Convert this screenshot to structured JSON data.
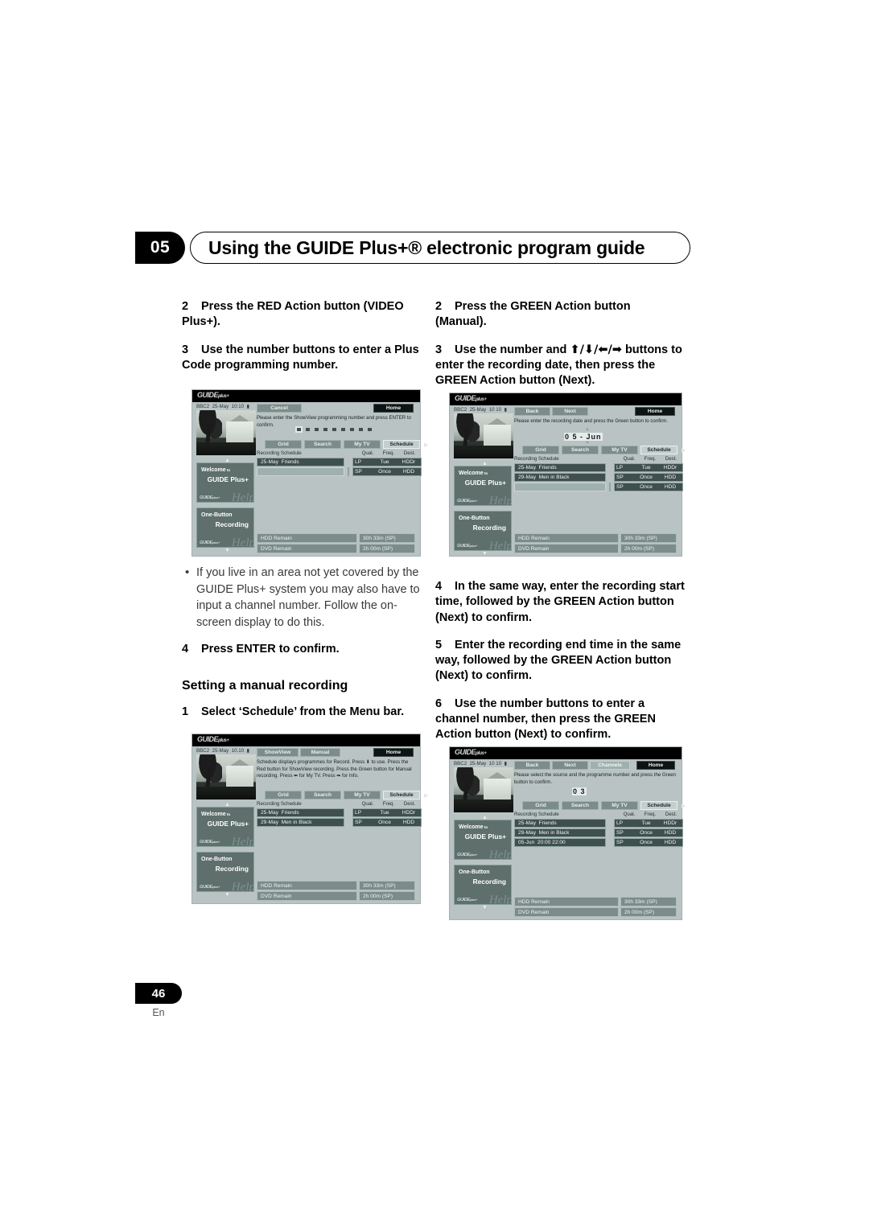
{
  "header": {
    "chapter": "05",
    "title": "Using the GUIDE Plus+® electronic program guide"
  },
  "footer": {
    "page": "46",
    "lang": "En"
  },
  "left_column": {
    "step2": {
      "num": "2",
      "text": "Press the RED Action button (VIDEO Plus+)."
    },
    "step3": {
      "num": "3",
      "text": "Use the number buttons to enter a Plus Code  programming number."
    },
    "bullet": "If you live in an area not yet covered by the GUIDE Plus+ system you may also have to input a channel number. Follow the on-screen display to do this.",
    "step4": {
      "num": "4",
      "text": "Press ENTER to confirm."
    },
    "subhead": "Setting a manual recording",
    "step1": {
      "num": "1",
      "text": "Select ‘Schedule’ from the Menu bar."
    }
  },
  "right_column": {
    "step2": {
      "num": "2",
      "text": "Press the GREEN Action button (Manual)."
    },
    "step3": {
      "num": "3",
      "pre": "Use the number and ",
      "arrows": "⬆/⬇/⬅/➡",
      "post": " buttons to enter the recording date, then press the GREEN Action button (Next)."
    },
    "step4": {
      "num": "4",
      "text": "In the same way, enter the recording start time, followed by the GREEN Action button (Next) to confirm."
    },
    "step5": {
      "num": "5",
      "text": "Enter the recording end time in the same way, followed by the GREEN Action button (Next) to confirm."
    },
    "step6": {
      "num": "6",
      "text": "Use the number buttons to enter a channel number, then press the GREEN Action button (Next) to confirm."
    }
  },
  "screens": {
    "showview_entry": {
      "logo": "GUIDE",
      "logo_sm": "plus+",
      "channel": "BBC2",
      "date": "25-May",
      "time": "10:10",
      "lock": "🔒",
      "buttons": [
        "Cancel",
        "Home"
      ],
      "message": "Please enter the ShowView programming number and press ENTER to confirm.",
      "digit_count": 9,
      "tabs": [
        "Grid",
        "Search",
        "My TV",
        "Schedule"
      ],
      "active_tab": "Schedule",
      "schedule_label": "Recording Schedule",
      "columns": [
        "Qual.",
        "Freq.",
        "Dest."
      ],
      "rows": [
        {
          "date": "25-May",
          "title": "Friends",
          "qual": "LP",
          "freq": "Tue",
          "dest": "HDDr"
        },
        {
          "date": "",
          "title": "",
          "qual": "SP",
          "freq": "Once",
          "dest": "HDD"
        }
      ],
      "cards": [
        {
          "l1": "Welcome",
          "l1_tiny": "to",
          "l2": "GUIDE Plus+"
        },
        {
          "l1": "One-Button",
          "l1_tiny": "",
          "l2": "Recording"
        }
      ],
      "remain": [
        {
          "label": "HDD Remain",
          "value": "30h 33m (SP)"
        },
        {
          "label": "DVD Remain",
          "value": "2h 00m (SP)"
        }
      ]
    },
    "manual_date": {
      "logo": "GUIDE",
      "logo_sm": "plus+",
      "channel": "BBC2",
      "date": "25-May",
      "time": "10 10",
      "lock": "🔒",
      "buttons": [
        "Back",
        "Next",
        "Home"
      ],
      "message": "Please enter the recording date and press the Green button to confirm.",
      "value": "0 5 - Jun",
      "tabs": [
        "Grid",
        "Search",
        "My TV",
        "Schedule"
      ],
      "active_tab": "Schedule",
      "schedule_label": "Recording Schedule",
      "columns": [
        "Qual.",
        "Freq.",
        "Dest."
      ],
      "rows": [
        {
          "date": "25-May",
          "title": "Friends",
          "qual": "LP",
          "freq": "Tue",
          "dest": "HDDr"
        },
        {
          "date": "29-May",
          "title": "Men in Black",
          "qual": "SP",
          "freq": "Once",
          "dest": "HDD"
        },
        {
          "date": "",
          "title": "",
          "qual": "SP",
          "freq": "Once",
          "dest": "HDD"
        }
      ],
      "cards": [
        {
          "l1": "Welcome",
          "l1_tiny": "to",
          "l2": "GUIDE Plus+"
        },
        {
          "l1": "One-Button",
          "l1_tiny": "",
          "l2": "Recording"
        }
      ],
      "remain": [
        {
          "label": "HDD Remain",
          "value": "30h 33m (SP)"
        },
        {
          "label": "DVD Remain",
          "value": "2h 00m (SP)"
        }
      ]
    },
    "schedule_menu": {
      "logo": "GUIDE",
      "logo_sm": "plus+",
      "channel": "BBC2",
      "date": "25-May",
      "time": "10.10",
      "lock": "🔒",
      "buttons": [
        "ShowView",
        "Manual",
        "Home"
      ],
      "message": "Schedule displays programmes for Record. Press ⬇ to use. Press the Red button for ShowView recording. Press the Green button for Manual recording. Press ⬅ for My TV. Press ➡ for Info.",
      "tabs": [
        "Grid",
        "Search",
        "My TV",
        "Schedule"
      ],
      "active_tab": "Schedule",
      "schedule_label": "Recording Schedule",
      "columns": [
        "Qual.",
        "Freq.",
        "Dest."
      ],
      "rows": [
        {
          "date": "25-May",
          "title": "Friends",
          "qual": "LP",
          "freq": "Tue",
          "dest": "HDDr"
        },
        {
          "date": "29-May",
          "title": "Men in Black",
          "qual": "SP",
          "freq": "Once",
          "dest": "HDD"
        }
      ],
      "cards": [
        {
          "l1": "Welcome",
          "l1_tiny": "to",
          "l2": "GUIDE Plus+"
        },
        {
          "l1": "One-Button",
          "l1_tiny": "",
          "l2": "Recording"
        }
      ],
      "remain": [
        {
          "label": "HDD Remain",
          "value": "30h 33m (SP)"
        },
        {
          "label": "DVD Remain",
          "value": "2h 00m (SP)"
        }
      ]
    },
    "manual_channel": {
      "logo": "GUIDE",
      "logo_sm": "plus+",
      "channel": "BBC2",
      "date": "25-May",
      "time": "10 10",
      "lock": "🔒",
      "buttons": [
        "Back",
        "Next",
        "Channels",
        "Home"
      ],
      "message": "Please select the source and the programme number and press the Green button to confirm.",
      "value": "0 3",
      "tabs": [
        "Grid",
        "Search",
        "My TV",
        "Schedule"
      ],
      "active_tab": "Schedule",
      "schedule_label": "Recording Schedule",
      "columns": [
        "Qual.",
        "Freq.",
        "Dest."
      ],
      "rows": [
        {
          "date": "25-May",
          "title": "Friends",
          "qual": "LP",
          "freq": "Tue",
          "dest": "HDDr"
        },
        {
          "date": "29-May",
          "title": "Men in Black",
          "qual": "SP",
          "freq": "Once",
          "dest": "HDD"
        },
        {
          "date": "05-Jun",
          "title": "20:00  22:00",
          "qual": "SP",
          "freq": "Once",
          "dest": "HDD"
        }
      ],
      "cards": [
        {
          "l1": "Welcome",
          "l1_tiny": "to",
          "l2": "GUIDE Plus+"
        },
        {
          "l1": "One-Button",
          "l1_tiny": "",
          "l2": "Recording"
        }
      ],
      "remain": [
        {
          "label": "HDD Remain",
          "value": "30h 33m (SP)"
        },
        {
          "label": "DVD Remain",
          "value": "2h 00m (SP)"
        }
      ]
    }
  }
}
